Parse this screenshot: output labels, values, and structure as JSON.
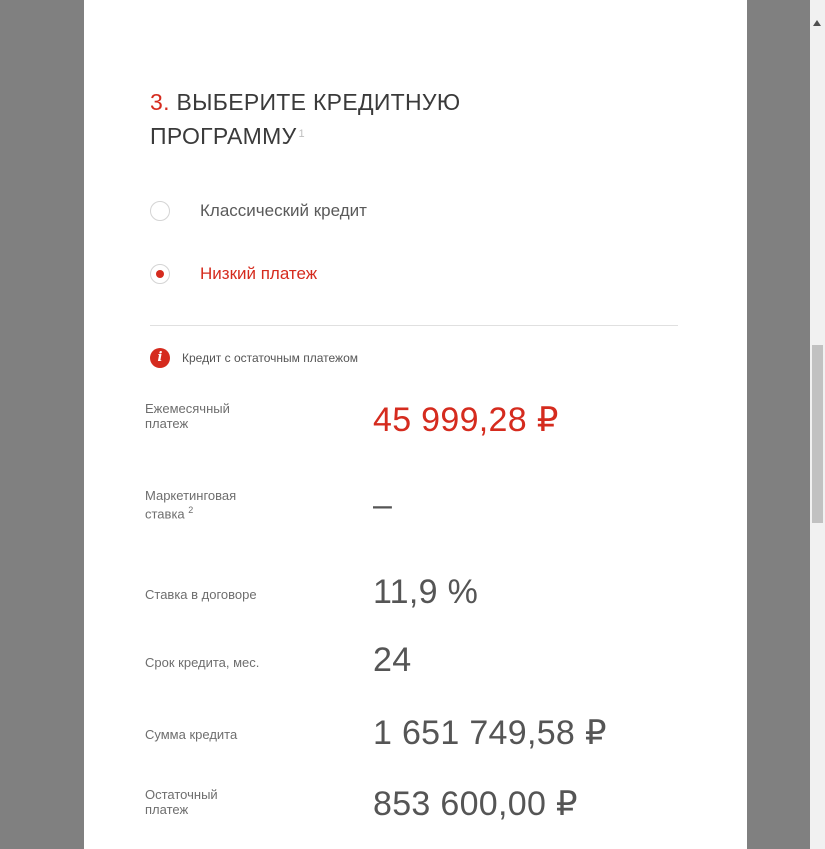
{
  "section": {
    "step_number": "3.",
    "title": "ВЫБЕРИТЕ КРЕДИТНУЮ ПРОГРАММУ",
    "title_footnote": "1"
  },
  "programs": {
    "options": [
      {
        "label": "Классический кредит",
        "selected": false
      },
      {
        "label": "Низкий платеж",
        "selected": true
      }
    ]
  },
  "info": {
    "icon": "info-icon",
    "text": "Кредит с остаточным платежом"
  },
  "details": {
    "monthly_payment": {
      "label": "Ежемесячный платеж",
      "value": "45 999,28 ₽"
    },
    "marketing_rate": {
      "label": "Маркетинговая ставка",
      "footnote": "2",
      "value": "–"
    },
    "contract_rate": {
      "label": "Ставка в договоре",
      "value": "11,9 %"
    },
    "term": {
      "label": "Срок кредита, мес.",
      "value": "24"
    },
    "loan_amount": {
      "label": "Сумма кредита",
      "value": "1 651 749,58 ₽"
    },
    "residual_payment": {
      "label": "Остаточный платеж",
      "value": "853 600,00 ₽"
    }
  },
  "colors": {
    "accent": "#d52b1e",
    "text": "#555555",
    "gutter": "#808080"
  }
}
